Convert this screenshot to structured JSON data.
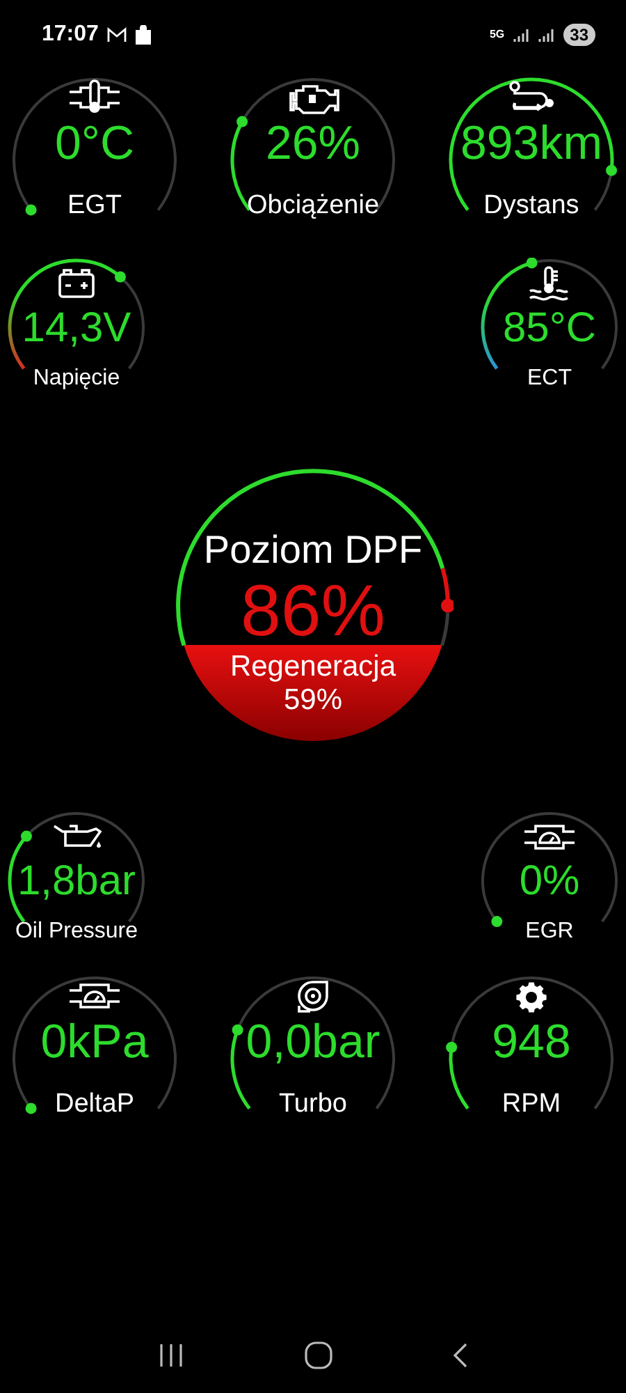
{
  "status_bar": {
    "time": "17:07",
    "network": "5G",
    "battery": "33"
  },
  "top_row": [
    {
      "label": "EGT",
      "value": "0°C",
      "kind": "plain"
    },
    {
      "label": "Obciążenie",
      "value": "26%",
      "kind": "plain"
    },
    {
      "label": "Dystans",
      "value": "893km",
      "kind": "plain"
    }
  ],
  "side_row_1": [
    {
      "label": "Napięcie",
      "value": "14,3V",
      "kind": "voltage"
    },
    {
      "label": "ECT",
      "value": "85°C",
      "kind": "coolant"
    }
  ],
  "dpf": {
    "title": "Poziom DPF",
    "value": "86%",
    "alert": true,
    "regeneration_label": "Regeneracja",
    "regeneration_value": "59%"
  },
  "side_row_2": [
    {
      "label": "Oil Pressure",
      "value": "1,8bar",
      "kind": "plain"
    },
    {
      "label": "EGR",
      "value": "0%",
      "kind": "plain"
    }
  ],
  "bottom_row": [
    {
      "label": "DeltaP",
      "value": "0kPa",
      "kind": "plain"
    },
    {
      "label": "Turbo",
      "value": "0,0bar",
      "kind": "plain"
    },
    {
      "label": "RPM",
      "value": "948",
      "kind": "plain"
    }
  ]
}
